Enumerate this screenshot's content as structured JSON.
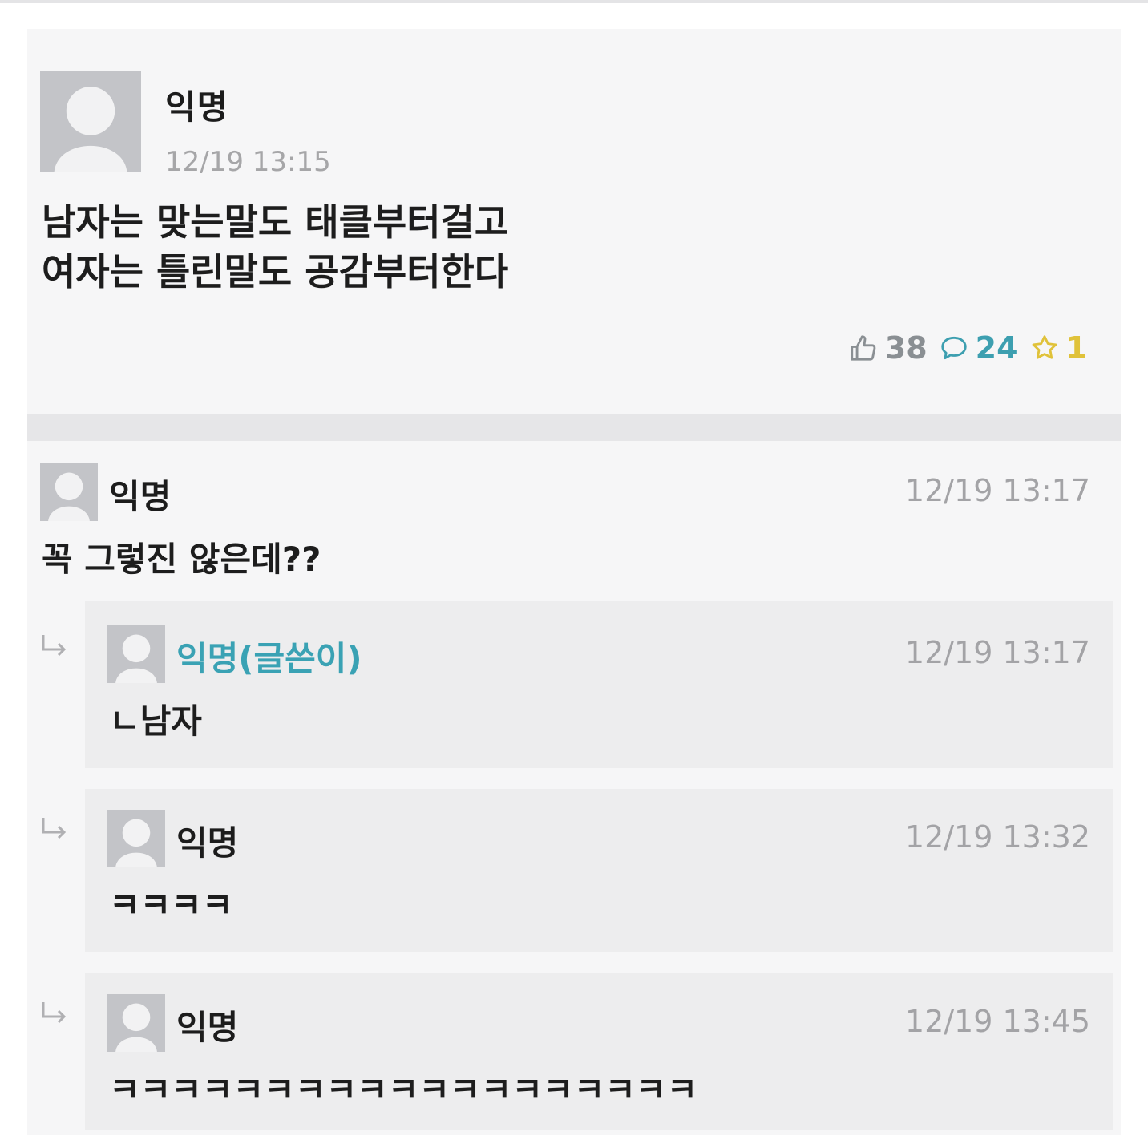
{
  "post": {
    "author": "익명",
    "time": "12/19 13:15",
    "line1": "남자는 맞는말도 태클부터걸고",
    "line2": "여자는 틀린말도 공감부터한다",
    "likes": "38",
    "comments": "24",
    "scraps": "1"
  },
  "colors": {
    "writer": "#3aa2b4",
    "comment_count": "#3d9fb0",
    "scrap": "#e0c23a"
  },
  "comments": [
    {
      "author": "익명",
      "time": "12/19 13:17",
      "text": "꼭 그렇진 않은데??"
    }
  ],
  "replies": [
    {
      "author": "익명(글쓴이)",
      "time": "12/19 13:17",
      "text": "ㄴ남자"
    },
    {
      "author": "익명",
      "time": "12/19 13:32",
      "text": "ㅋㅋㅋㅋ"
    },
    {
      "author": "익명",
      "time": "12/19 13:45",
      "text": "ㅋㅋㅋㅋㅋㅋㅋㅋㅋㅋㅋㅋㅋㅋㅋㅋㅋㅋㅋ"
    }
  ]
}
